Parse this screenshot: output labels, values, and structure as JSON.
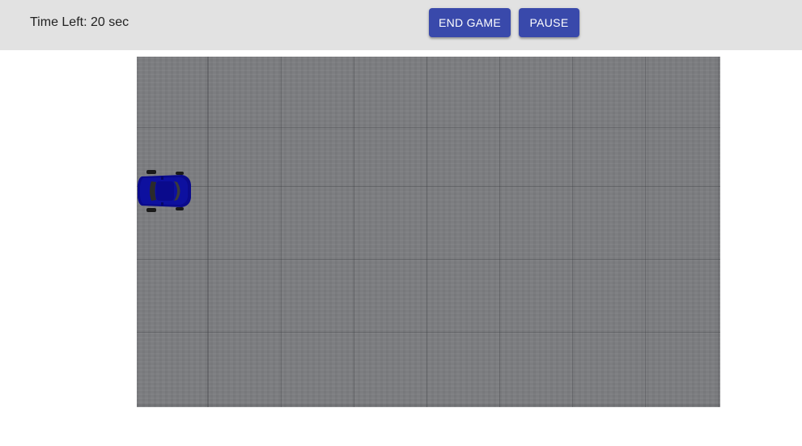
{
  "header": {
    "timer_text": "Time Left: 20 sec",
    "end_game_label": "END GAME",
    "pause_label": "PAUSE"
  },
  "colors": {
    "header_bg": "#e2e2e2",
    "button_bg": "#3949ab",
    "road": "#7c7d80",
    "car_body": "#0a0a8c"
  },
  "game": {
    "player_car_icon": "blue-sports-car-top-view-icon"
  }
}
